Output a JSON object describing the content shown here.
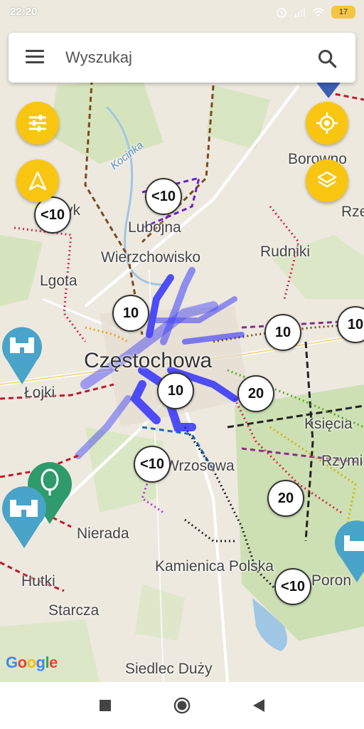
{
  "status_bar": {
    "time": "22:20",
    "battery": "17"
  },
  "search": {
    "placeholder": "Wyszukaj"
  },
  "icons": {
    "menu": "hamburger-menu-icon",
    "search": "magnifier-icon",
    "filters": "sliders-icon",
    "navigation": "navigation-arrow-icon",
    "my_location": "crosshair-icon",
    "layers": "layers-icon"
  },
  "colors": {
    "accent": "#f8c611",
    "route_highlight": "#1a1aff",
    "pin_castle": "#4aa3c8",
    "pin_tree": "#2f9a6b"
  },
  "map_labels": {
    "lubojna": "Lubojna",
    "wierzchowisko": "Wierzchowisko",
    "lgota": "Lgota",
    "czestochowa": "Częstochowa",
    "lojki": "Łojki",
    "nierada": "Nierada",
    "hutki": "Hutki",
    "starcza": "Starcza",
    "kamienica_polska": "Kamienica Polska",
    "siedlec_duzy": "Siedlec Duży",
    "borowno": "Borowno",
    "rudniki": "Rudniki",
    "rze": "Rze",
    "ksiecia": "Księcia",
    "rzymi": "Rzymi",
    "wrzosowa": "Wrzosowa",
    "poron": "Poron",
    "kocinka": "Kocinka",
    "yk": "yk"
  },
  "clusters": {
    "c1": "<10",
    "c2": "<10",
    "c3": "10",
    "c4": "10",
    "c5": "10",
    "c6": "10",
    "c7": "20",
    "c8": "<10",
    "c9": "20",
    "c10": "<10"
  },
  "google": "Google"
}
